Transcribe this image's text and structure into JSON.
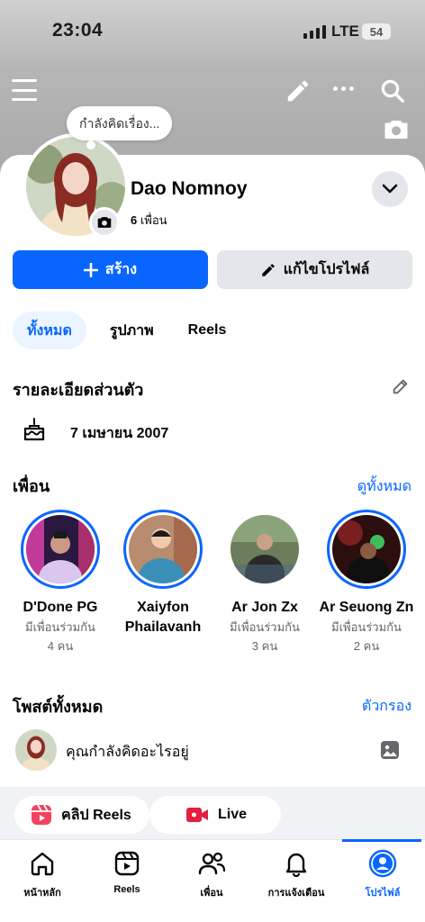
{
  "status_bar": {
    "time": "23:04",
    "network": "LTE",
    "battery": "54"
  },
  "header": {
    "icons": [
      "menu-icon",
      "pencil-icon",
      "more-icon",
      "search-icon",
      "camera-icon"
    ]
  },
  "profile": {
    "thought_prompt": "กำลังคิดเรื่อง...",
    "name": "Dao Nomnoy",
    "friends_count": "6",
    "friends_word": "เพื่อน"
  },
  "actions": {
    "create_label": "สร้าง",
    "edit_label": "แก้ไขโปรไฟล์"
  },
  "tabs": [
    {
      "label": "ทั้งหมด",
      "active": true
    },
    {
      "label": "รูปภาพ",
      "active": false
    },
    {
      "label": "Reels",
      "active": false
    }
  ],
  "details": {
    "title": "รายละเอียดส่วนตัว",
    "birthday": "7 เมษายน  2007"
  },
  "friends": {
    "title": "เพื่อน",
    "see_all": "ดูทั้งหมด",
    "items": [
      {
        "name": "D'Done PG",
        "mutual": "มีเพื่อนร่วมกัน",
        "count": "4 คน"
      },
      {
        "name": "Xaiyfon Phailavanh",
        "mutual": "",
        "count": ""
      },
      {
        "name": "Ar Jon Zx",
        "mutual": "มีเพื่อนร่วมกัน",
        "count": "3 คน"
      },
      {
        "name": "Ar Seuong Zn",
        "mutual": "มีเพื่อนร่วมกัน",
        "count": "2 คน"
      }
    ]
  },
  "posts": {
    "title": "โพสต์ทั้งหมด",
    "filter": "ตัวกรอง",
    "prompt": "คุณกำลังคิดอะไรอยู่"
  },
  "chips": {
    "reels_label": "คลิป Reels",
    "live_label": "Live"
  },
  "nav": {
    "items": [
      {
        "label": "หน้าหลัก",
        "icon": "home-icon",
        "active": false
      },
      {
        "label": "Reels",
        "icon": "reels-icon",
        "active": false
      },
      {
        "label": "เพื่อน",
        "icon": "friends-icon",
        "active": false
      },
      {
        "label": "การแจ้งเตือน",
        "icon": "bell-icon",
        "active": false
      },
      {
        "label": "โปรไฟล์",
        "icon": "profile-icon",
        "active": true
      }
    ]
  },
  "colors": {
    "accent": "#0866ff",
    "live_red": "#e41e3f",
    "reels_red": "#f3425f"
  }
}
